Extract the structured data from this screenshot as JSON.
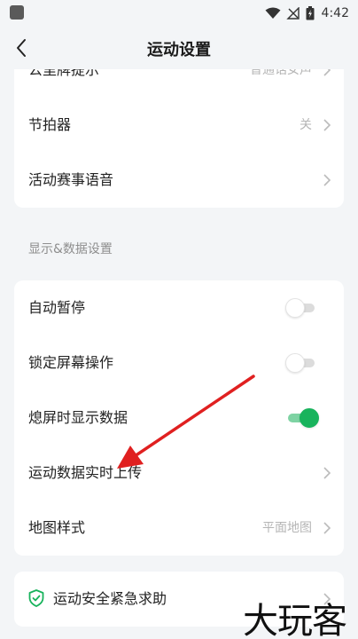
{
  "status_bar": {
    "time": "4:42"
  },
  "nav": {
    "title": "运动设置",
    "back_icon": "back-arrow-icon"
  },
  "card_voice": {
    "items": [
      {
        "label": "公里牌提示",
        "value": "普通话女声"
      },
      {
        "label": "节拍器",
        "value": "关"
      },
      {
        "label": "活动赛事语音",
        "value": ""
      }
    ]
  },
  "section_display": {
    "title": "显示&数据设置"
  },
  "card_display": {
    "items": [
      {
        "label": "自动暂停",
        "toggle": false
      },
      {
        "label": "锁定屏幕操作",
        "toggle": false
      },
      {
        "label": "熄屏时显示数据",
        "toggle": true
      },
      {
        "label": "运动数据实时上传",
        "value": ""
      },
      {
        "label": "地图样式",
        "value": "平面地图"
      }
    ]
  },
  "card_safety": {
    "label": "运动安全紧急求助",
    "icon": "shield-check-icon"
  },
  "watermark": {
    "text": "大玩客"
  },
  "colors": {
    "accent_green": "#18b35c",
    "annotation_red": "#e02020"
  }
}
